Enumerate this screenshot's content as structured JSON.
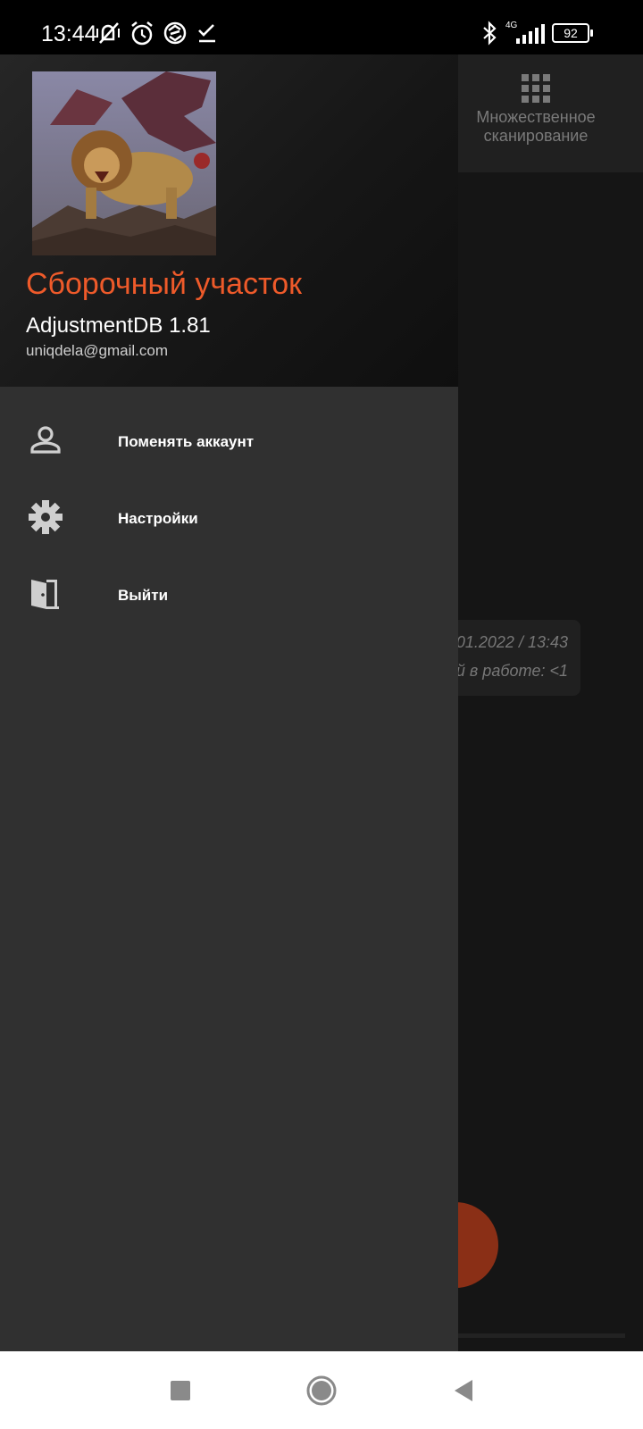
{
  "status_bar": {
    "time": "13:44",
    "network": "4G",
    "battery": "92",
    "icons": [
      "vibrate-muted-icon",
      "alarm-icon",
      "sync-icon",
      "checkmark-icon",
      "bluetooth-icon",
      "signal-icon",
      "battery-icon"
    ]
  },
  "background": {
    "multiscan_label": "Множественное сканирование",
    "card_line1": "01.2022 / 13:43",
    "card_line2": "ей в работе:  <1"
  },
  "drawer": {
    "title": "Сборочный участок",
    "app_version": "AdjustmentDB 1.81",
    "email": "uniqdela@gmail.com",
    "menu": [
      {
        "label": "Поменять аккаунт",
        "icon": "person-icon"
      },
      {
        "label": "Настройки",
        "icon": "gear-icon"
      },
      {
        "label": "Выйти",
        "icon": "exit-door-icon"
      }
    ]
  },
  "colors": {
    "accent": "#ee5a2a",
    "drawer_bg": "#303030",
    "header_bg": "#1a1a1a"
  }
}
